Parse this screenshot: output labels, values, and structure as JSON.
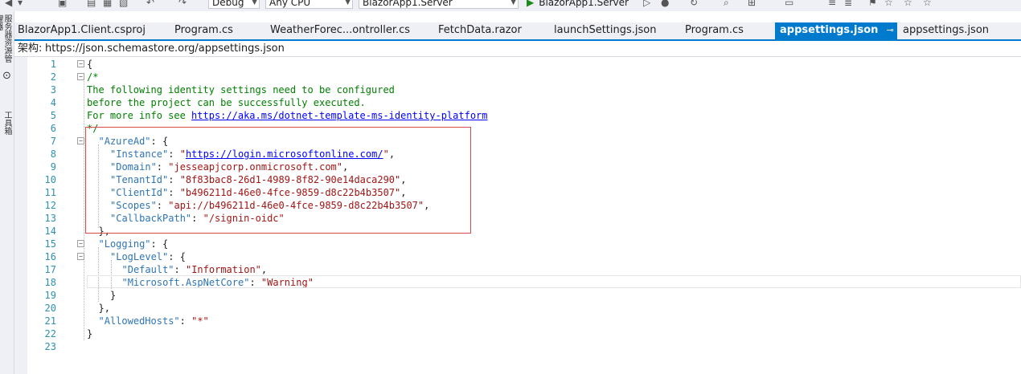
{
  "toolbar": {
    "config": "Debug",
    "platform": "Any CPU",
    "project": "BlazorApp1.Server",
    "run_target": "BlazorApp1.Server"
  },
  "left_strip": {
    "item1": "服务器资源管理器",
    "item2": "工具箱"
  },
  "tabs": [
    {
      "label": "BlazorApp1.Client.csproj"
    },
    {
      "label": "Program.cs"
    },
    {
      "label": "WeatherForec...ontroller.cs"
    },
    {
      "label": "FetchData.razor"
    },
    {
      "label": "launchSettings.json"
    },
    {
      "label": "Program.cs"
    },
    {
      "label": "appsettings.json",
      "active": true
    },
    {
      "label": "appsettings.json"
    }
  ],
  "schema": {
    "label": "架构:",
    "url": "https://json.schemastore.org/appsettings.json"
  },
  "code_lines": [
    {
      "n": "1",
      "text": "{"
    },
    {
      "n": "2",
      "text": "/*"
    },
    {
      "n": "3",
      "text": "The following identity settings need to be configured"
    },
    {
      "n": "4",
      "text": "before the project can be successfully executed."
    },
    {
      "n": "5",
      "text": "For more info see ",
      "link": "https://aka.ms/dotnet-template-ms-identity-platform"
    },
    {
      "n": "6",
      "text": "*/"
    },
    {
      "n": "7",
      "key": "\"AzureAd\"",
      "rest": ": {"
    },
    {
      "n": "8",
      "key": "\"Instance\"",
      "sep": ": ",
      "q1": "\"",
      "link": "https://login.microsoftonline.com/",
      "q2": "\"",
      "end": ","
    },
    {
      "n": "9",
      "key": "\"Domain\"",
      "sep": ": ",
      "val": "\"jesseapjcorp.onmicrosoft.com\"",
      "end": ","
    },
    {
      "n": "10",
      "key": "\"TenantId\"",
      "sep": ": ",
      "val": "\"8f83bac8-26d1-4989-8f82-90e14daca290\"",
      "end": ","
    },
    {
      "n": "11",
      "key": "\"ClientId\"",
      "sep": ": ",
      "val": "\"b496211d-46e0-4fce-9859-d8c22b4b3507\"",
      "end": ","
    },
    {
      "n": "12",
      "key": "\"Scopes\"",
      "sep": ": ",
      "val": "\"api://b496211d-46e0-4fce-9859-d8c22b4b3507\"",
      "end": ","
    },
    {
      "n": "13",
      "key": "\"CallbackPath\"",
      "sep": ": ",
      "val": "\"/signin-oidc\"",
      "end": ""
    },
    {
      "n": "14",
      "text": "},"
    },
    {
      "n": "15",
      "key": "\"Logging\"",
      "rest": ": {"
    },
    {
      "n": "16",
      "key": "\"LogLevel\"",
      "rest": ": {"
    },
    {
      "n": "17",
      "key": "\"Default\"",
      "sep": ": ",
      "val": "\"Information\"",
      "end": ","
    },
    {
      "n": "18",
      "key": "\"Microsoft.AspNetCore\"",
      "sep": ": ",
      "val": "\"Warning\"",
      "end": ""
    },
    {
      "n": "19",
      "text": "}"
    },
    {
      "n": "20",
      "text": "},"
    },
    {
      "n": "21",
      "key": "\"AllowedHosts\"",
      "sep": ": ",
      "val": "\"*\"",
      "end": ""
    },
    {
      "n": "22",
      "text": "}"
    },
    {
      "n": "23",
      "text": ""
    }
  ]
}
